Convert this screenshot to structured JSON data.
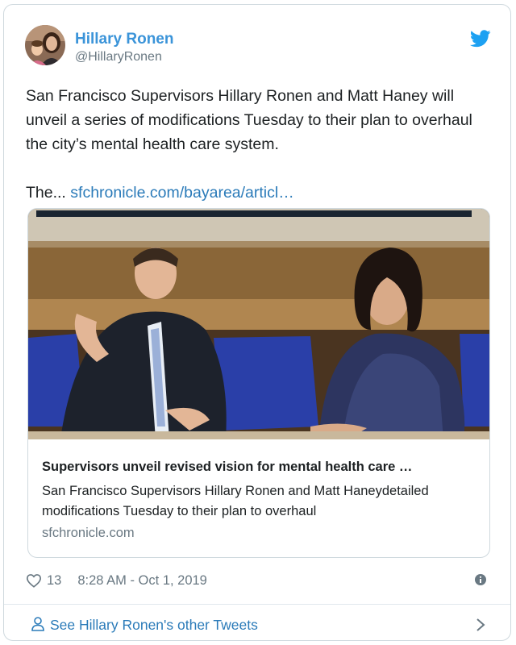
{
  "author": {
    "name": "Hillary Ronen",
    "handle": "@HillaryRonen",
    "avatar_icon": "avatar-photo"
  },
  "tweet": {
    "text": "San Francisco Supervisors Hillary Ronen and Matt Haney will unveil a series of modifications Tuesday to their plan to overhaul the city’s mental health care system.",
    "truncated_prefix": "The... ",
    "link_text": "sfchronicle.com/bayarea/articl…"
  },
  "card": {
    "image_description_icon": "article-photo",
    "title": "Supervisors unveil revised vision for mental health care …",
    "description": "San Francisco Supervisors Hillary Ronen and Matt Haneydetailed modifications Tuesday to their plan to overhaul",
    "domain": "sfchronicle.com"
  },
  "footer": {
    "like_count": "13",
    "timestamp": "8:28 AM - Oct 1, 2019"
  },
  "see_more": {
    "label": "See Hillary Ronen's other Tweets"
  },
  "colors": {
    "brand_blue": "#1da1f2",
    "link": "#2b7bb9",
    "name": "#3b94d9",
    "muted": "#697882",
    "border": "#cfd9de"
  }
}
